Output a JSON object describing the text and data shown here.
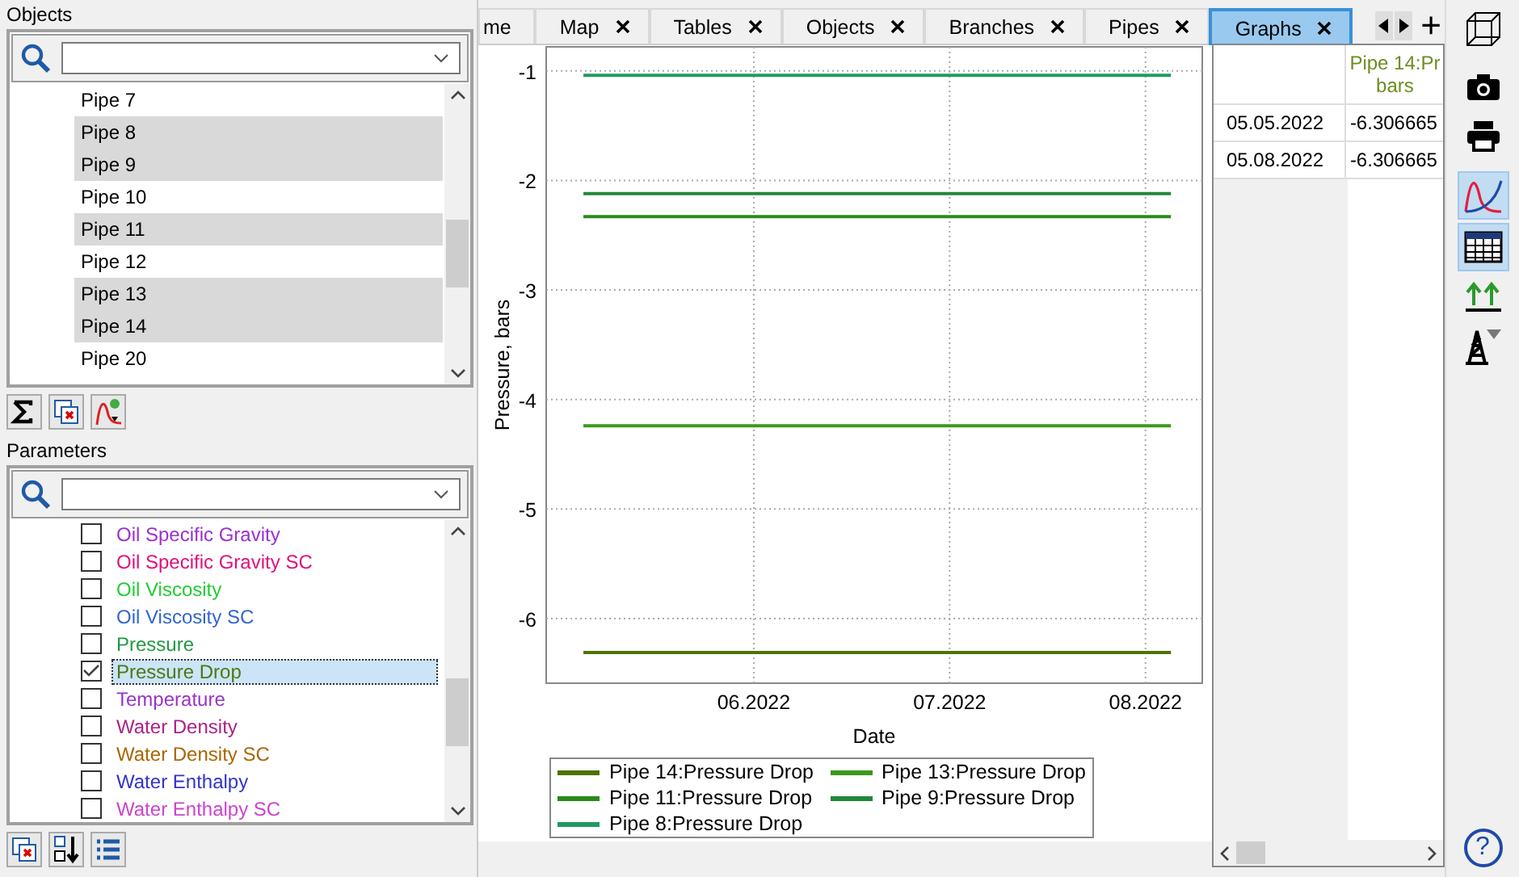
{
  "objects": {
    "title": "Objects",
    "items": [
      {
        "label": "Pipe 7",
        "selected": false
      },
      {
        "label": "Pipe 8",
        "selected": true
      },
      {
        "label": "Pipe 9",
        "selected": true
      },
      {
        "label": "Pipe 10",
        "selected": false
      },
      {
        "label": "Pipe 11",
        "selected": true
      },
      {
        "label": "Pipe 12",
        "selected": false
      },
      {
        "label": "Pipe 13",
        "selected": true
      },
      {
        "label": "Pipe 14",
        "selected": true
      },
      {
        "label": "Pipe 20",
        "selected": false
      }
    ]
  },
  "parameters": {
    "title": "Parameters",
    "items": [
      {
        "label": "Oil Specific Gravity",
        "checked": false,
        "selected": false,
        "color": "#9b30d0"
      },
      {
        "label": "Oil Specific Gravity SC",
        "checked": false,
        "selected": false,
        "color": "#e0107a"
      },
      {
        "label": "Oil Viscosity",
        "checked": false,
        "selected": false,
        "color": "#22cc33"
      },
      {
        "label": "Oil Viscosity SC",
        "checked": false,
        "selected": false,
        "color": "#3366cc"
      },
      {
        "label": "Pressure",
        "checked": false,
        "selected": false,
        "color": "#229944"
      },
      {
        "label": "Pressure Drop",
        "checked": true,
        "selected": true,
        "color": "#4a7a10"
      },
      {
        "label": "Temperature",
        "checked": false,
        "selected": false,
        "color": "#9933cc"
      },
      {
        "label": "Water Density",
        "checked": false,
        "selected": false,
        "color": "#aa2288"
      },
      {
        "label": "Water Density SC",
        "checked": false,
        "selected": false,
        "color": "#aa6600"
      },
      {
        "label": "Water Enthalpy",
        "checked": false,
        "selected": false,
        "color": "#3333cc"
      },
      {
        "label": "Water Enthalpy SC",
        "checked": false,
        "selected": false,
        "color": "#cc44cc"
      }
    ]
  },
  "tabs": [
    {
      "label": "me",
      "selected": false,
      "closable": false
    },
    {
      "label": "Map",
      "selected": false,
      "closable": true
    },
    {
      "label": "Tables",
      "selected": false,
      "closable": true
    },
    {
      "label": "Objects",
      "selected": false,
      "closable": true
    },
    {
      "label": "Branches",
      "selected": false,
      "closable": true
    },
    {
      "label": "Pipes",
      "selected": false,
      "closable": true
    },
    {
      "label": "Graphs",
      "selected": true,
      "closable": true
    }
  ],
  "tab_add": "+",
  "chart": {
    "chart_data": {
      "type": "line",
      "xlabel": "Date",
      "ylabel": "Pressure, bars",
      "x": [
        5.3322,
        8.3322
      ],
      "grid": true,
      "xlim": [
        5.1422,
        8.4922
      ],
      "ylim": [
        -6.59,
        -0.78
      ],
      "xticks": [
        {
          "value": 6.2022,
          "label": "06.2022"
        },
        {
          "value": 7.2022,
          "label": "07.2022"
        },
        {
          "value": 8.2022,
          "label": "08.2022"
        }
      ],
      "yticks": [
        -1,
        -2,
        -3,
        -4,
        -5,
        -6
      ],
      "series": [
        {
          "name": "Pipe 14:Pressure Drop",
          "color": "#4d7300",
          "values": [
            -6.31,
            -6.31
          ]
        },
        {
          "name": "Pipe 13:Pressure Drop",
          "color": "#3a9a1a",
          "values": [
            -4.24,
            -4.24
          ]
        },
        {
          "name": "Pipe 11:Pressure Drop",
          "color": "#2a8a1a",
          "values": [
            -2.33,
            -2.33
          ]
        },
        {
          "name": "Pipe 9:Pressure Drop",
          "color": "#228838",
          "values": [
            -2.12,
            -2.12
          ]
        },
        {
          "name": "Pipe 8:Pressure Drop",
          "color": "#1f9a60",
          "values": [
            -1.04,
            -1.04
          ]
        }
      ]
    }
  },
  "table": {
    "header": [
      "Pipe 14:Pr",
      "bars"
    ],
    "rows": [
      {
        "date": "05.05.2022",
        "value": "-6.306665"
      },
      {
        "date": "05.08.2022",
        "value": "-6.306665"
      }
    ]
  },
  "right_toolbar": [
    {
      "kind": "cube",
      "selected": false
    },
    {
      "kind": "camera",
      "selected": false
    },
    {
      "kind": "printer",
      "selected": false
    },
    {
      "kind": "curve",
      "selected": true
    },
    {
      "kind": "grid",
      "selected": true
    },
    {
      "kind": "arrows",
      "selected": false
    },
    {
      "kind": "derrick",
      "selected": false
    }
  ],
  "help": "?"
}
